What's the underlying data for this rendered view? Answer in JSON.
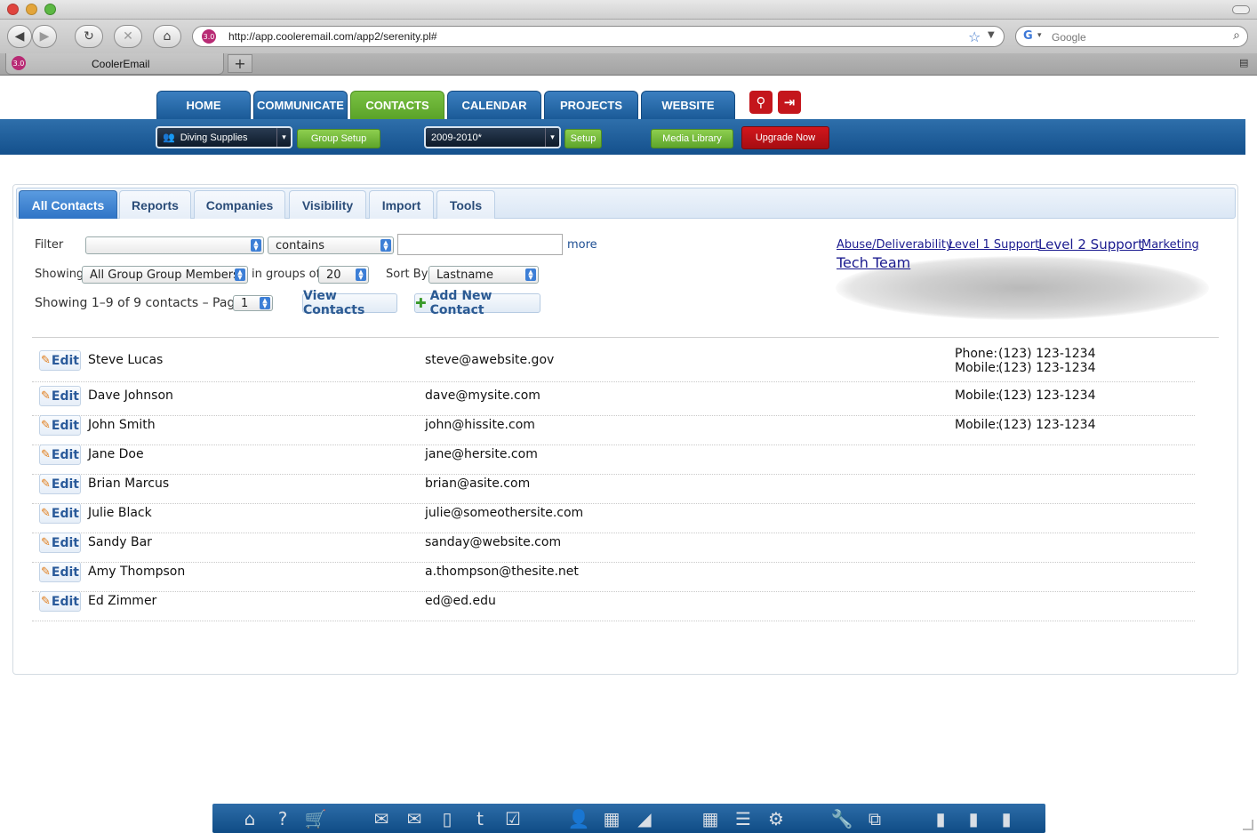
{
  "browser": {
    "url": "http://app.cooleremail.com/app2/serenity.pl#",
    "search_placeholder": "Google",
    "tab_title": "CoolerEmail",
    "favicon_text": "3.0"
  },
  "nav": {
    "tabs": [
      "HOME",
      "COMMUNICATE",
      "CONTACTS",
      "CALENDAR",
      "PROJECTS",
      "WEBSITE"
    ],
    "active": "CONTACTS"
  },
  "header": {
    "account_select": "Diving Supplies",
    "group_setup": "Group Setup",
    "year_select": "2009-2010*",
    "setup": "Setup",
    "media_library": "Media Library",
    "upgrade": "Upgrade Now"
  },
  "subtabs": [
    "All Contacts",
    "Reports",
    "Companies",
    "Visibility",
    "Import",
    "Tools"
  ],
  "filter": {
    "label": "Filter",
    "field_value": "",
    "operator": "contains",
    "text_value": "",
    "more": "more"
  },
  "showing": {
    "label": "Showing",
    "group": "All Group Group Members",
    "in_groups_of_label": "in groups of",
    "page_size": "20",
    "sort_by_label": "Sort By",
    "sort_by": "Lastname"
  },
  "pager": {
    "summary": "Showing 1–9 of 9 contacts – Page:",
    "page": "1",
    "view_contacts": "View Contacts",
    "add_new_contact": "Add New Contact"
  },
  "group_tags": [
    "Abuse/Deliverability",
    "Level 1 Support",
    "Level 2 Support",
    "Marketing",
    "Tech Team"
  ],
  "edit_label": "Edit",
  "phone_label": "Phone:",
  "mobile_label": "Mobile:",
  "contacts": [
    {
      "name": "Steve Lucas",
      "email": "steve@awebsite.gov",
      "phone": "(123) 123-1234",
      "mobile": "(123) 123-1234"
    },
    {
      "name": "Dave Johnson",
      "email": "dave@mysite.com",
      "mobile": "(123) 123-1234"
    },
    {
      "name": "John Smith",
      "email": "john@hissite.com",
      "mobile": "(123) 123-1234"
    },
    {
      "name": "Jane Doe",
      "email": "jane@hersite.com"
    },
    {
      "name": "Brian Marcus",
      "email": "brian@asite.com"
    },
    {
      "name": "Julie Black",
      "email": "julie@someothersite.com"
    },
    {
      "name": "Sandy Bar",
      "email": "sanday@website.com"
    },
    {
      "name": "Amy Thompson",
      "email": "a.thompson@thesite.net"
    },
    {
      "name": "Ed Zimmer",
      "email": "ed@ed.edu"
    }
  ],
  "dock_icons": [
    "home-icon",
    "help-icon",
    "cart-icon",
    "mail-icon",
    "mail-open-icon",
    "mobile-icon",
    "twitter-icon",
    "checklist-icon",
    "person-icon",
    "calculator-icon",
    "chart-icon",
    "grid-icon",
    "list-icon",
    "gear-icon",
    "wrench-icon",
    "network-icon",
    "document-icon",
    "document-download-icon",
    "document-upload-icon"
  ]
}
